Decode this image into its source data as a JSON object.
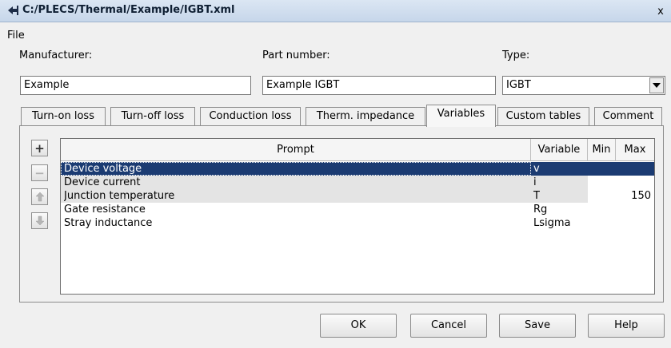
{
  "window": {
    "title": "C:/PLECS/Thermal/Example/IGBT.xml",
    "close_glyph": "x"
  },
  "menu": {
    "file": "File"
  },
  "fields": {
    "manufacturer_label": "Manufacturer:",
    "manufacturer_value": "Example",
    "part_number_label": "Part number:",
    "part_number_value": "Example IGBT",
    "type_label": "Type:",
    "type_value": "IGBT"
  },
  "tabs": [
    {
      "label": "Turn-on loss"
    },
    {
      "label": "Turn-off loss"
    },
    {
      "label": "Conduction loss"
    },
    {
      "label": "Therm. impedance"
    },
    {
      "label": "Variables",
      "active": true
    },
    {
      "label": "Custom tables"
    },
    {
      "label": "Comment"
    }
  ],
  "side_buttons": {
    "add": "+",
    "remove": "−"
  },
  "table": {
    "headers": {
      "prompt": "Prompt",
      "variable": "Variable",
      "min": "Min",
      "max": "Max"
    },
    "rows": [
      {
        "prompt": "Device voltage",
        "variable": "v",
        "min": "",
        "max": ""
      },
      {
        "prompt": "Device current",
        "variable": "i",
        "min": "",
        "max": ""
      },
      {
        "prompt": "Junction temperature",
        "variable": "T",
        "min": "",
        "max": "150"
      },
      {
        "prompt": "Gate resistance",
        "variable": "Rg",
        "min": "",
        "max": ""
      },
      {
        "prompt": "Stray inductance",
        "variable": "Lsigma",
        "min": "",
        "max": ""
      }
    ]
  },
  "buttons": {
    "ok": "OK",
    "cancel": "Cancel",
    "save": "Save",
    "help": "Help"
  },
  "colors": {
    "selection": "#1b3b72",
    "titlebar": "#c6d6ea"
  }
}
